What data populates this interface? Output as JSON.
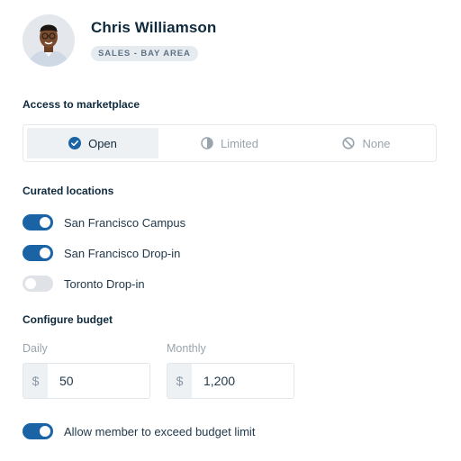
{
  "profile": {
    "name": "Chris Williamson",
    "badge": "SALES - BAY AREA"
  },
  "marketplace": {
    "title": "Access to marketplace",
    "options": [
      {
        "label": "Open",
        "icon": "check-circle-icon",
        "selected": true
      },
      {
        "label": "Limited",
        "icon": "pie-icon",
        "selected": false
      },
      {
        "label": "None",
        "icon": "prohibited-icon",
        "selected": false
      }
    ]
  },
  "locations": {
    "title": "Curated locations",
    "items": [
      {
        "label": "San Francisco Campus",
        "enabled": true
      },
      {
        "label": "San Francisco Drop-in",
        "enabled": true
      },
      {
        "label": "Toronto Drop-in",
        "enabled": false
      }
    ]
  },
  "budget": {
    "title": "Configure budget",
    "daily": {
      "label": "Daily",
      "currency": "$",
      "value": "50"
    },
    "monthly": {
      "label": "Monthly",
      "currency": "$",
      "value": "1,200"
    },
    "exceed": {
      "label": "Allow member to exceed budget limit",
      "enabled": true
    }
  },
  "colors": {
    "accent": "#1a63a5",
    "text": "#0f2a3d",
    "muted": "#9aa4ae",
    "segment_active_bg": "#eef1f4"
  }
}
